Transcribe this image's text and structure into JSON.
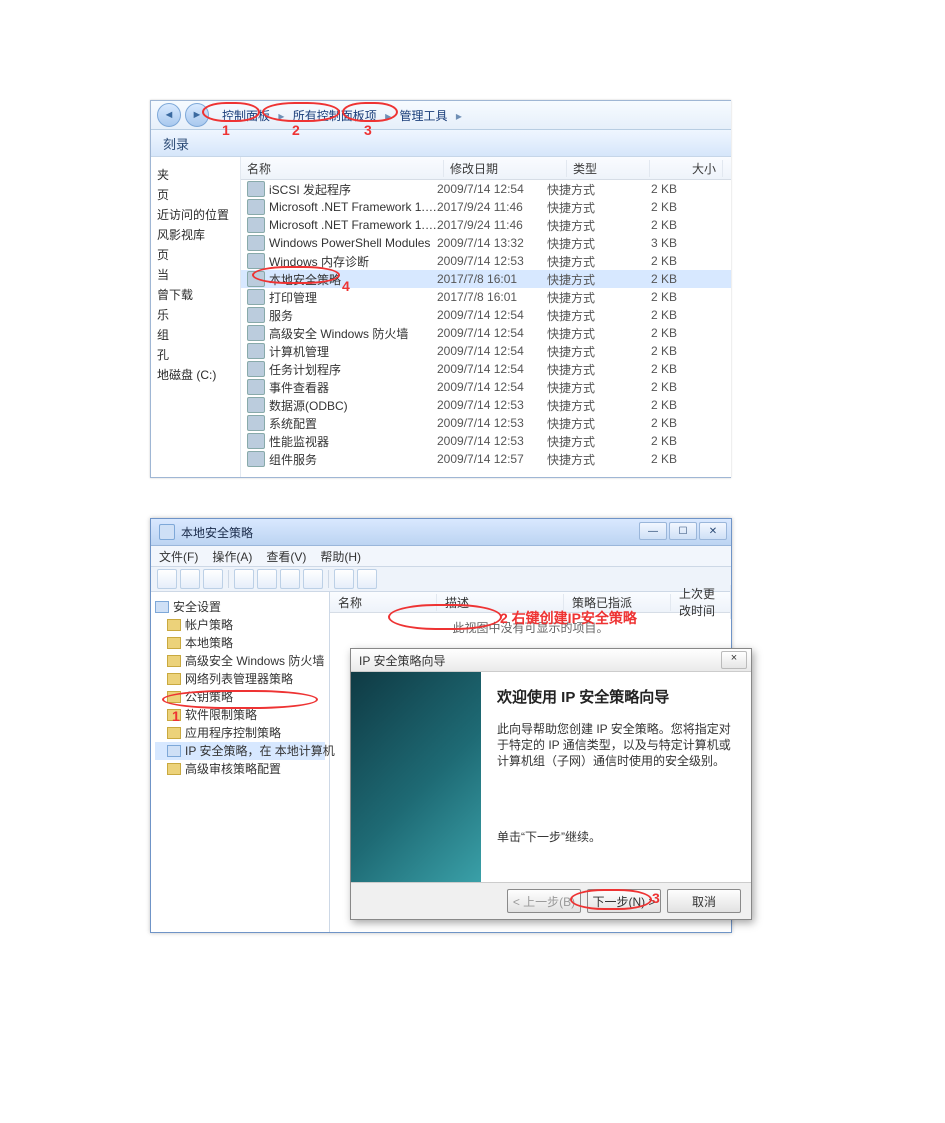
{
  "breadcrumb": {
    "b1": "控制面板",
    "b2": "所有控制面板项",
    "b3": "管理工具",
    "arrow": "▸"
  },
  "toolbar": {
    "burn": "刻录"
  },
  "annotations": {
    "a1": "1",
    "a2": "2",
    "a3": "3",
    "a4": "4",
    "a5": "1",
    "a6": "2 右键创建IP安全策略",
    "a7": "3"
  },
  "cols": {
    "name": "名称",
    "date": "修改日期",
    "type": "类型",
    "size": "大小"
  },
  "side": [
    "夹",
    "页",
    "近访问的位置",
    "",
    "风影视库",
    "页",
    "当",
    "",
    "曾下载",
    "乐",
    "",
    "组",
    "孔",
    "地磁盘 (C:)"
  ],
  "items": [
    {
      "n": "iSCSI 发起程序",
      "d": "2009/7/14 12:54",
      "t": "快捷方式",
      "s": "2 KB"
    },
    {
      "n": "Microsoft .NET Framework 1.1 Confi...",
      "d": "2017/9/24 11:46",
      "t": "快捷方式",
      "s": "2 KB"
    },
    {
      "n": "Microsoft .NET Framework 1.1 Wizar...",
      "d": "2017/9/24 11:46",
      "t": "快捷方式",
      "s": "2 KB"
    },
    {
      "n": "Windows PowerShell Modules",
      "d": "2009/7/14 13:32",
      "t": "快捷方式",
      "s": "3 KB"
    },
    {
      "n": "Windows 内存诊断",
      "d": "2009/7/14 12:53",
      "t": "快捷方式",
      "s": "2 KB"
    },
    {
      "n": "本地安全策略",
      "d": "2017/7/8 16:01",
      "t": "快捷方式",
      "s": "2 KB"
    },
    {
      "n": "打印管理",
      "d": "2017/7/8 16:01",
      "t": "快捷方式",
      "s": "2 KB"
    },
    {
      "n": "服务",
      "d": "2009/7/14 12:54",
      "t": "快捷方式",
      "s": "2 KB"
    },
    {
      "n": "高级安全 Windows 防火墙",
      "d": "2009/7/14 12:54",
      "t": "快捷方式",
      "s": "2 KB"
    },
    {
      "n": "计算机管理",
      "d": "2009/7/14 12:54",
      "t": "快捷方式",
      "s": "2 KB"
    },
    {
      "n": "任务计划程序",
      "d": "2009/7/14 12:54",
      "t": "快捷方式",
      "s": "2 KB"
    },
    {
      "n": "事件查看器",
      "d": "2009/7/14 12:54",
      "t": "快捷方式",
      "s": "2 KB"
    },
    {
      "n": "数据源(ODBC)",
      "d": "2009/7/14 12:53",
      "t": "快捷方式",
      "s": "2 KB"
    },
    {
      "n": "系统配置",
      "d": "2009/7/14 12:53",
      "t": "快捷方式",
      "s": "2 KB"
    },
    {
      "n": "性能监视器",
      "d": "2009/7/14 12:53",
      "t": "快捷方式",
      "s": "2 KB"
    },
    {
      "n": "组件服务",
      "d": "2009/7/14 12:57",
      "t": "快捷方式",
      "s": "2 KB"
    }
  ],
  "mmc": {
    "title": "本地安全策略",
    "menu": {
      "file": "文件(F)",
      "action": "操作(A)",
      "view": "查看(V)",
      "help": "帮助(H)"
    },
    "tree": [
      {
        "t": "安全设置",
        "cls": "sec",
        "ind": ""
      },
      {
        "t": "帐户策略",
        "cls": "",
        "ind": "ind1"
      },
      {
        "t": "本地策略",
        "cls": "",
        "ind": "ind1"
      },
      {
        "t": "高级安全 Windows 防火墙",
        "cls": "",
        "ind": "ind1"
      },
      {
        "t": "网络列表管理器策略",
        "cls": "",
        "ind": "ind1"
      },
      {
        "t": "公钥策略",
        "cls": "",
        "ind": "ind1"
      },
      {
        "t": "软件限制策略",
        "cls": "",
        "ind": "ind1"
      },
      {
        "t": "应用程序控制策略",
        "cls": "",
        "ind": "ind1"
      },
      {
        "t": "IP 安全策略，在 本地计算机",
        "cls": "sec",
        "ind": "ind1 sel"
      },
      {
        "t": "高级审核策略配置",
        "cls": "",
        "ind": "ind1"
      }
    ],
    "cols": {
      "name": "名称",
      "desc": "描述",
      "assigned": "策略已指派",
      "last": "上次更改时间"
    },
    "empty": "此视图中没有可显示的项目。"
  },
  "wizard": {
    "title": "IP 安全策略向导",
    "heading": "欢迎使用 IP 安全策略向导",
    "p1": "此向导帮助您创建 IP 安全策略。您将指定对于特定的 IP 通信类型，以及与特定计算机或计算机组（子网）通信时使用的安全级别。",
    "p2": "单击“下一步”继续。",
    "back": "< 上一步(B)",
    "next": "下一步(N) >",
    "cancel": "取消",
    "close": "×"
  }
}
